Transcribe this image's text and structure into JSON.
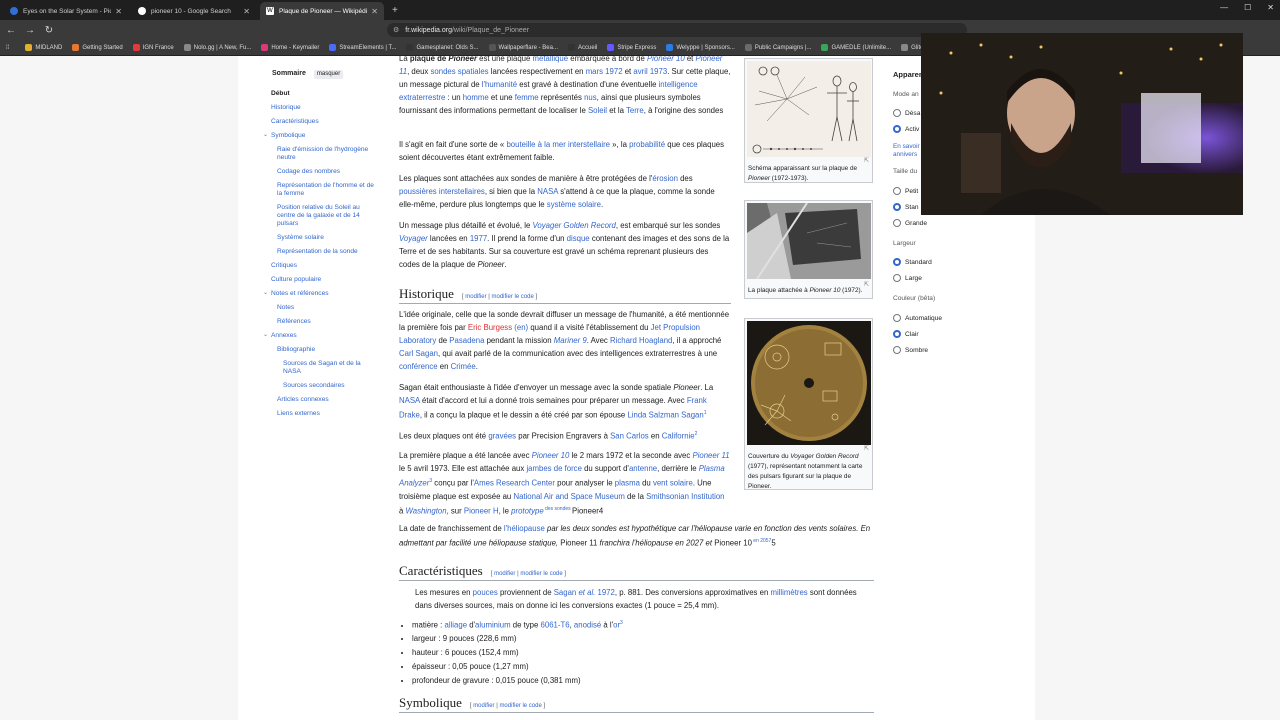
{
  "browser": {
    "tabs": [
      {
        "title": "Eyes on the Solar System - Pioneer",
        "color": "#2f6fd6",
        "active": false
      },
      {
        "title": "pioneer 10 - Google Search",
        "color": "#ffffff",
        "active": false
      },
      {
        "title": "Plaque de Pioneer — Wikipédia",
        "color": "#ffffff",
        "active": true
      }
    ],
    "new_tab": "+",
    "url_host": "fr.wikipedia.org",
    "url_path": "/wiki/Plaque_de_Pioneer",
    "bookmarks": [
      {
        "label": "MIDLAND",
        "color": "#e0b030"
      },
      {
        "label": "Getting Started",
        "color": "#e8772e"
      },
      {
        "label": "IGN France",
        "color": "#e23a3a"
      },
      {
        "label": "Nolo.gg | A New, Fu...",
        "color": "#888888"
      },
      {
        "label": "Home - Keymailer",
        "color": "#d63b7a"
      },
      {
        "label": "StreamElements | T...",
        "color": "#4a6cf7"
      },
      {
        "label": "Gamesplanet: Olds S...",
        "color": "#333333"
      },
      {
        "label": "Wallpaperflare - Bea...",
        "color": "#555555"
      },
      {
        "label": "Accueil",
        "color": "#333333"
      },
      {
        "label": "Stripe Express",
        "color": "#635bff"
      },
      {
        "label": "Welyppe | Sponsors...",
        "color": "#2b7be5"
      },
      {
        "label": "Public Campaigns |...",
        "color": "#6a6a6a"
      },
      {
        "label": "GAMEDLE (Unlimite...",
        "color": "#3aa45a"
      },
      {
        "label": "Glitch Exp",
        "color": "#888888"
      }
    ]
  },
  "toc": {
    "title": "Sommaire",
    "hide": "masquer",
    "items": [
      "Début",
      "Historique",
      "Caractéristiques",
      "Symbolique",
      "Raie d'émission de l'hydrogène neutre",
      "Codage des nombres",
      "Représentation de l'homme et de la femme",
      "Position relative du Soleil au centre de la galaxie et de 14 pulsars",
      "Système solaire",
      "Représentation de la sonde",
      "Critiques",
      "Culture populaire",
      "Notes et références",
      "Notes",
      "Références",
      "Annexes",
      "Bibliographie",
      "Sources de Sagan et de la NASA",
      "Sources secondaires",
      "Articles connexes",
      "Liens externes"
    ]
  },
  "article": {
    "intro1": [
      "La ",
      "plaque de ",
      "Pioneer",
      " est une plaque ",
      "métallique",
      " embarquée à bord de ",
      "Pioneer 10",
      " et ",
      "Pioneer 11",
      ", deux ",
      "sondes spatiales",
      " lancées respectivement en ",
      "mars 1972",
      " et ",
      "avril 1973",
      ". Sur cette plaque, un message pictural de ",
      "l'humanité",
      " est gravé à destination d'une éventuelle ",
      "intelligence extraterrestre",
      " : un ",
      "homme",
      " et une ",
      "femme",
      " représentés ",
      "nus",
      ", ainsi que plusieurs symboles fournissant des informations permettant de localiser le ",
      "Soleil",
      " et la ",
      "Terre",
      ", à l'origine des sondes"
    ],
    "intro2": [
      "Il s'agit en fait d'une sorte de « ",
      "bouteille à la mer interstellaire",
      " », la ",
      "probabilité",
      " que ces plaques soient découvertes étant extrêmement faible."
    ],
    "intro3": [
      "Les plaques sont attachées aux sondes de manière à être protégées de l'",
      "érosion",
      " des ",
      "poussières interstellaires",
      ", si bien que la ",
      "NASA",
      " s'attend à ce que la plaque, comme la sonde elle-même, perdure plus longtemps que le ",
      "système solaire",
      "."
    ],
    "intro4": [
      "Un message plus détaillé et évolué, le ",
      "Voyager Golden Record",
      ", est embarqué sur les sondes ",
      "Voyager",
      " lancées en ",
      "1977",
      ". Il prend la forme d'un ",
      "disque",
      " contenant des images et des sons de la Terre et de ses habitants. Sur sa couverture est gravé un schéma reprenant plusieurs des codes de la plaque de ",
      "Pioneer",
      "."
    ],
    "h_hist": "Historique",
    "edit": "modifier",
    "edit_code": "modifier le code",
    "hist1": [
      "L'idée originale, celle que la sonde devrait diffuser un message de l'humanité, a été mentionnée la première fois par ",
      "Eric Burgess",
      " (en)",
      " quand il a visité l'établissement du ",
      "Jet Propulsion Laboratory",
      " de ",
      "Pasadena",
      " pendant la mission ",
      "Mariner 9",
      ". Avec ",
      "Richard Hoagland",
      ", il a approché ",
      "Carl Sagan",
      ", qui avait parlé de la communication avec des intelligences extraterrestres à une ",
      "conférence",
      " en ",
      "Crimée",
      "."
    ],
    "hist2": [
      "Sagan était enthousiaste à l'idée d'envoyer un message avec la sonde spatiale ",
      "Pioneer",
      ". La ",
      "NASA",
      " était d'accord et lui a donné trois semaines pour préparer un message. Avec ",
      "Frank Drake",
      ", il a conçu la plaque et le dessin a été créé par son épouse ",
      "Linda Salzman Sagan",
      "1"
    ],
    "hist3": [
      "Les deux plaques ont été ",
      "gravées",
      " par Precision Engravers à ",
      "San Carlos",
      " en ",
      "Californie",
      "2"
    ],
    "hist4": [
      "La première plaque a été lancée avec ",
      "Pioneer 10",
      " le 2 mars 1972 et la seconde avec ",
      "Pioneer 11",
      " le 5 avril 1973. Elle est attachée aux ",
      "jambes de force",
      " du support d'",
      "antenne",
      ", derrière le ",
      "Plasma Analyzer",
      "3",
      " conçu par l'",
      "Ames Research Center",
      " pour analyser le ",
      "plasma",
      " du ",
      "vent solaire",
      ". Une troisième plaque est exposée au ",
      "National Air and Space Museum",
      " de la ",
      "Smithsonian Institution",
      " à ",
      "Washington",
      ", sur ",
      "Pioneer H",
      ", le ",
      "prototype",
      " des sondes ",
      "Pioneer",
      "4"
    ],
    "hist5": [
      "La date de franchissement de ",
      "l'héliopause",
      " par les deux sondes est hypothétique car l'héliopause varie en fonction des vents solaires. En admettant par facilité une héliopause statique, ",
      "Pioneer 11",
      " franchira l'héliopause en 2027 et ",
      "Pioneer 10",
      " en 2057",
      "5"
    ],
    "h_carac": "Caractéristiques",
    "carac_note": [
      "Les mesures en ",
      "pouces",
      " proviennent de ",
      "Sagan ",
      "et al.",
      " 1972",
      ", p. 881. Des conversions approximatives en ",
      "millimètres",
      " sont données dans diverses sources, mais on donne ici les conversions exactes (1 pouce = 25,4 mm)."
    ],
    "carac_list": [
      [
        "matière : ",
        "alliage",
        " d'",
        "aluminium",
        " de type ",
        "6061-T6",
        ", ",
        "anodisé",
        " à l'",
        "or",
        "3"
      ],
      [
        "largeur : 9 pouces (228,6 mm)"
      ],
      [
        "hauteur : 6 pouces (152,4 mm)"
      ],
      [
        "épaisseur : 0,05 pouce (1,27 mm)"
      ],
      [
        "profondeur de gravure : 0,015 pouce (0,381 mm)"
      ]
    ],
    "h_symb": "Symbolique"
  },
  "figures": {
    "cap1": [
      "Schéma apparaissant sur la plaque de ",
      "Pioneer",
      " (1972-1973)."
    ],
    "cap2": [
      "La plaque attachée à ",
      "Pioneer 10",
      " (1972)."
    ],
    "cap3": [
      "Couverture du ",
      "Voyager Golden Record",
      " (1977), représentant notamment la carte des pulsars figurant sur la plaque de ",
      "Pioneer",
      "."
    ]
  },
  "apparence": {
    "title": "Apparen",
    "mode_label": "Mode an",
    "mode_opts": [
      "Désa",
      "Activ"
    ],
    "mode_link": [
      "En savoir",
      "annivers"
    ],
    "size_label": "Taille du",
    "size_opts": [
      "Petit",
      "Stan",
      "Grande"
    ],
    "width_label": "Largeur",
    "width_opts": [
      "Standard",
      "Large"
    ],
    "color_label": "Couleur (bêta)",
    "color_opts": [
      "Automatique",
      "Clair",
      "Sombre"
    ]
  }
}
